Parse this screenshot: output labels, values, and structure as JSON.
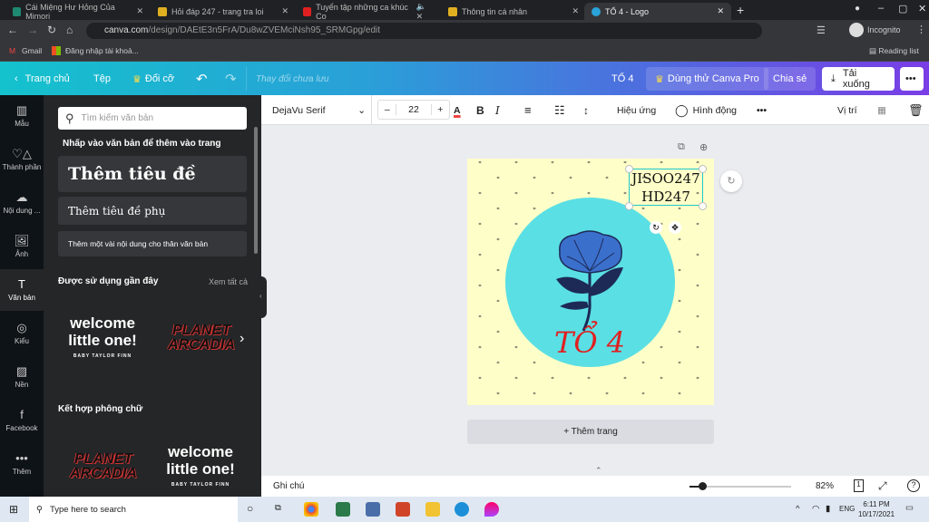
{
  "browser": {
    "tabs": [
      {
        "title": "Cái Miệng Hư Hỏng Của Mimori",
        "color": "#1e8a72"
      },
      {
        "title": "Hỏi đáp 247 - trang tra loi",
        "color": "#e0b020"
      },
      {
        "title": "Tuyển tập những ca khúc Co",
        "color": "#e02020"
      },
      {
        "title": "Thông tin cá nhân",
        "color": "#e0b020"
      },
      {
        "title": "TỔ 4 - Logo",
        "color": "#2aa3d8"
      }
    ],
    "url_host": "canva.com",
    "url_path": "/design/DAEtE3n5FrA/Du8wZVEMciNsh95_SRMGpg/edit",
    "profile": "Incognito",
    "bookmarks": [
      "Gmail",
      "Đăng nhập tài khoả..."
    ],
    "reading_list": "Reading list"
  },
  "header": {
    "home": "Trang chủ",
    "file": "Tệp",
    "resize": "Đổi cỡ",
    "status": "Thay đổi chưa lưu",
    "title": "TỔ 4",
    "try_pro": "Dùng thử Canva Pro",
    "share": "Chia sẻ",
    "download": "Tải xuống"
  },
  "rail": [
    {
      "label": "Mẫu",
      "icon": "▥"
    },
    {
      "label": "Thành phần",
      "icon": "♡△"
    },
    {
      "label": "Nội dung ...",
      "icon": "☁"
    },
    {
      "label": "Ảnh",
      "icon": "🖼"
    },
    {
      "label": "Văn bản",
      "icon": "T"
    },
    {
      "label": "Kiểu",
      "icon": "◎"
    },
    {
      "label": "Nền",
      "icon": "▨"
    },
    {
      "label": "Facebook",
      "icon": "f"
    },
    {
      "label": "Thêm",
      "icon": "•••"
    }
  ],
  "panel": {
    "search_placeholder": "Tìm kiếm văn bản",
    "hint": "Nhấp vào văn bản để thêm vào trang",
    "heading": "Thêm tiêu đề",
    "subheading": "Thêm tiêu đề phụ",
    "body": "Thêm một vài nội dung cho thân văn bản",
    "recent": "Được sử dụng gần đây",
    "see_all": "Xem tất cả",
    "combos": "Kết hợp phông chữ",
    "samples": {
      "welcome1": "welcome",
      "welcome2": "little one!",
      "welcome_sub": "BABY TAYLOR FINN",
      "planet1": "PLANET",
      "planet2": "ARCADIA"
    }
  },
  "toolbar": {
    "font": "DejaVu Serif",
    "size": "22",
    "effects": "Hiệu ứng",
    "animate": "Hình động",
    "position": "Vị trí"
  },
  "design": {
    "text_line1": "JISOO247",
    "text_line2": "HD247",
    "logo_text": "TỔ 4",
    "bg": "#fefec8",
    "circle": "#5adfe4"
  },
  "add_page": "+ Thêm trang",
  "bottom": {
    "notes": "Ghi chú",
    "zoom": "82%",
    "zoom_fraction": 0.12,
    "page": "1"
  },
  "taskbar": {
    "search": "Type here to search",
    "lang": "ENG",
    "time": "6:11 PM",
    "date": "10/17/2021"
  }
}
